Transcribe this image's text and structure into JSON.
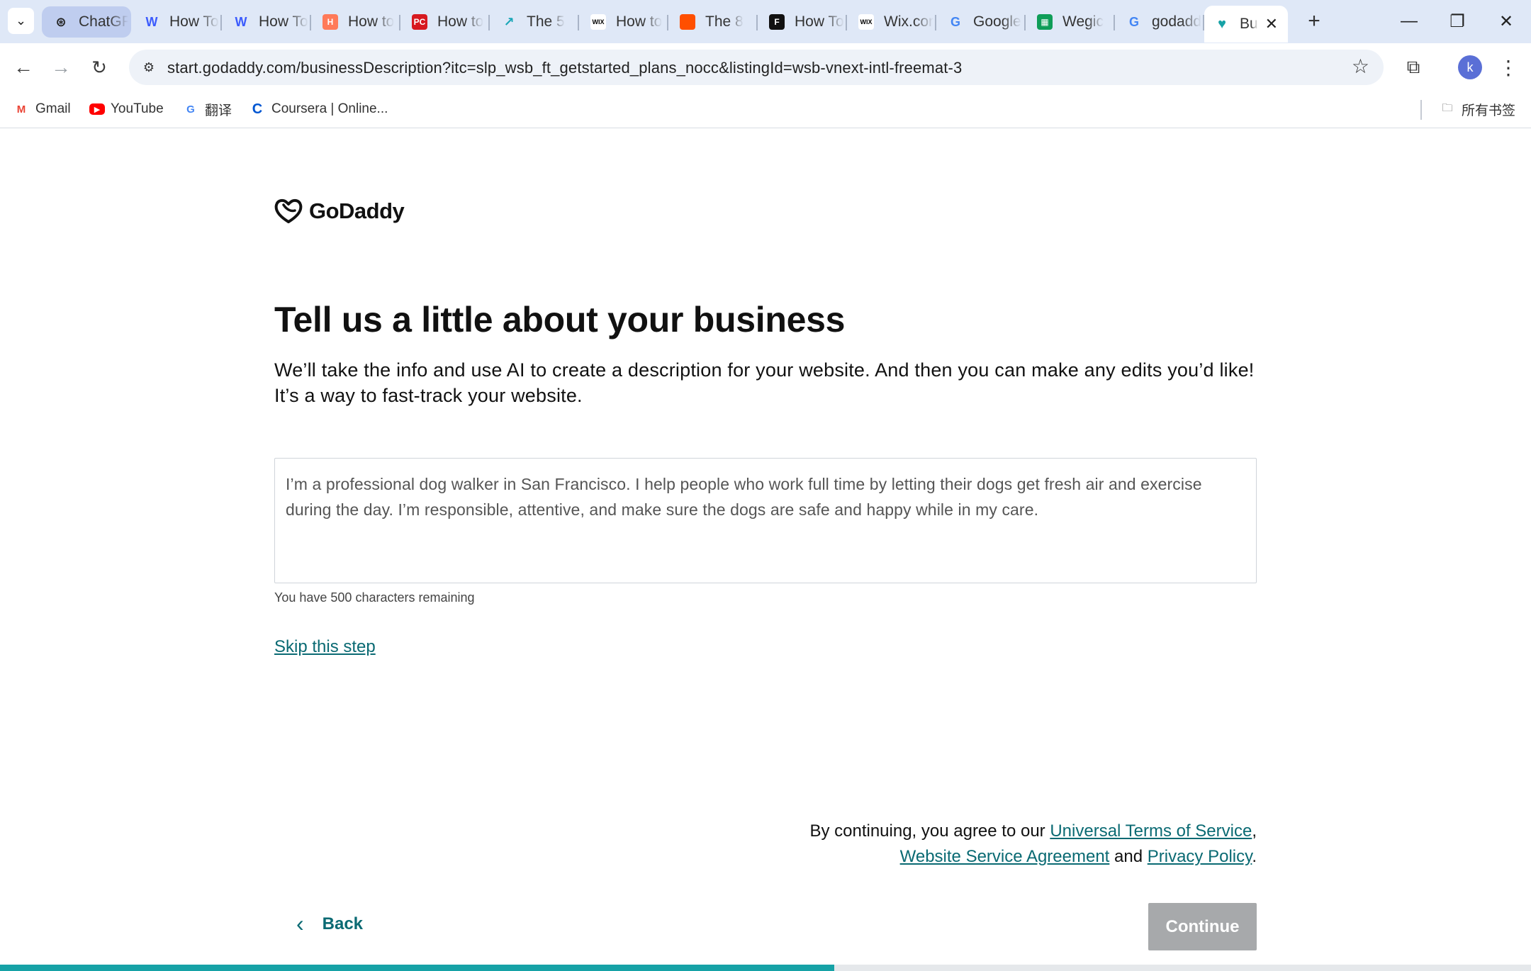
{
  "browser": {
    "tabs": [
      {
        "title": "ChatGPT",
        "icon": "openai-icon",
        "color": "#222222"
      },
      {
        "title": "How To",
        "icon": "webflow-icon",
        "color": "#3b5bfd"
      },
      {
        "title": "How To",
        "icon": "webflow-icon",
        "color": "#3b5bfd"
      },
      {
        "title": "How to",
        "icon": "hubspot-icon",
        "color": "#ff7a59"
      },
      {
        "title": "How to",
        "icon": "pcmag-icon",
        "color": "#d71920"
      },
      {
        "title": "The 5",
        "icon": "site-icon",
        "color": "#1aa6b7"
      },
      {
        "title": "How to",
        "icon": "wix-icon",
        "color": "#000000"
      },
      {
        "title": "The 8",
        "icon": "square-icon",
        "color": "#ff4f00"
      },
      {
        "title": "How To",
        "icon": "forbes-icon",
        "color": "#111111"
      },
      {
        "title": "Wix.com",
        "icon": "wix-icon",
        "color": "#000000"
      },
      {
        "title": "Google",
        "icon": "translate-icon",
        "color": "#4285f4"
      },
      {
        "title": "Wegic",
        "icon": "sheets-icon",
        "color": "#0f9d58"
      },
      {
        "title": "godaddy",
        "icon": "google-icon",
        "color": "#4285f4"
      }
    ],
    "active_tab": {
      "title": "Bu",
      "icon": "godaddy-icon",
      "color": "#16a2a6"
    },
    "url": "start.godaddy.com/businessDescription?itc=slp_wsb_ft_getstarted_plans_nocc&listingId=wsb-vnext-intl-freemat-3",
    "profile_initial": "k",
    "bookmarks": [
      {
        "label": "Gmail",
        "icon": "gmail-icon",
        "color": "#ea4335"
      },
      {
        "label": "YouTube",
        "icon": "youtube-icon",
        "color": "#ff0000"
      },
      {
        "label": "翻译",
        "icon": "translate-icon",
        "color": "#4285f4"
      },
      {
        "label": "Coursera | Online...",
        "icon": "coursera-icon",
        "color": "#0056d2"
      }
    ],
    "all_bookmarks_label": "所有书签"
  },
  "page": {
    "brand": "GoDaddy",
    "heading": "Tell us a little about your business",
    "subtitle": "We’ll take the info and use AI to create a description for your website. And then you can make any edits you’d like! It’s a way to fast-track your website.",
    "description_placeholder": "I’m a professional dog walker in San Francisco. I help people who work full time by letting their dogs get fresh air and exercise during the day. I’m responsible, attentive, and make sure the dogs are safe and happy while in my care.",
    "char_count": "You have 500 characters remaining",
    "skip_label": "Skip this step",
    "terms": {
      "prefix": "By continuing, you agree to our ",
      "link1": "Universal Terms of Service",
      "comma": ",",
      "link2": "Website Service Agreement",
      "and": " and ",
      "link3": "Privacy Policy",
      "period": "."
    },
    "back_label": "Back",
    "continue_label": "Continue",
    "progress_fraction": 0.545,
    "accent_color": "#0a6a73",
    "progress_color": "#16a2a6"
  }
}
